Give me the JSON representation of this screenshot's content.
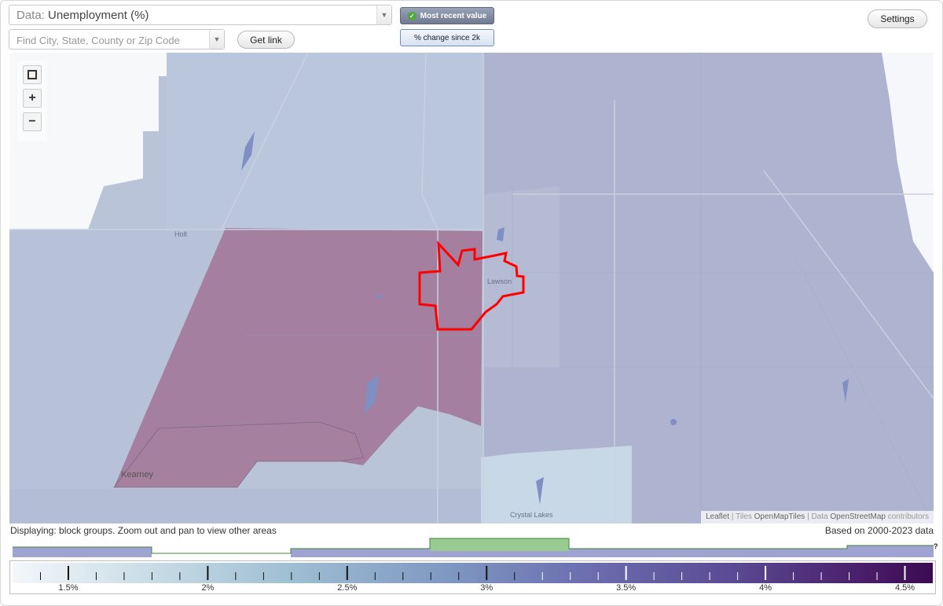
{
  "controls": {
    "data_select": {
      "prefix": "Data:",
      "value": "Unemployment (%)"
    },
    "search": {
      "placeholder": "Find City, State, County or Zip Code",
      "value": ""
    },
    "get_link_label": "Get link",
    "toggle_recent_label": "Most recent value",
    "toggle_change_label": "% change since 2k",
    "settings_label": "Settings"
  },
  "map": {
    "zoom_in": "+",
    "zoom_out": "−",
    "place_labels": [
      "Holt",
      "Lawson",
      "Kearney",
      "Crystal Lakes"
    ],
    "attribution": {
      "leaflet": "Leaflet",
      "sep1": " | Tiles ",
      "tiles": "OpenMapTiles",
      "sep2": " | Data ",
      "data": "OpenStreetMap",
      "tail": " contributors"
    }
  },
  "footer": {
    "status": "Displaying: block groups. Zoom out and pan to view other areas",
    "based_on": "Based on 2000-2023 data",
    "help": "?"
  },
  "legend": {
    "tick_labels": [
      "1.5%",
      "2%",
      "2.5%",
      "3%",
      "3.5%",
      "4%",
      "4.5%"
    ],
    "tick_values": [
      1.5,
      2,
      2.5,
      3,
      3.5,
      4,
      4.5
    ],
    "colors": {
      "low": "#f3f7fa",
      "mid": "#7d96c0",
      "high": "#3b0a52",
      "selected_outline": "#ff0000",
      "highlight_region": "#a47f9f"
    }
  }
}
